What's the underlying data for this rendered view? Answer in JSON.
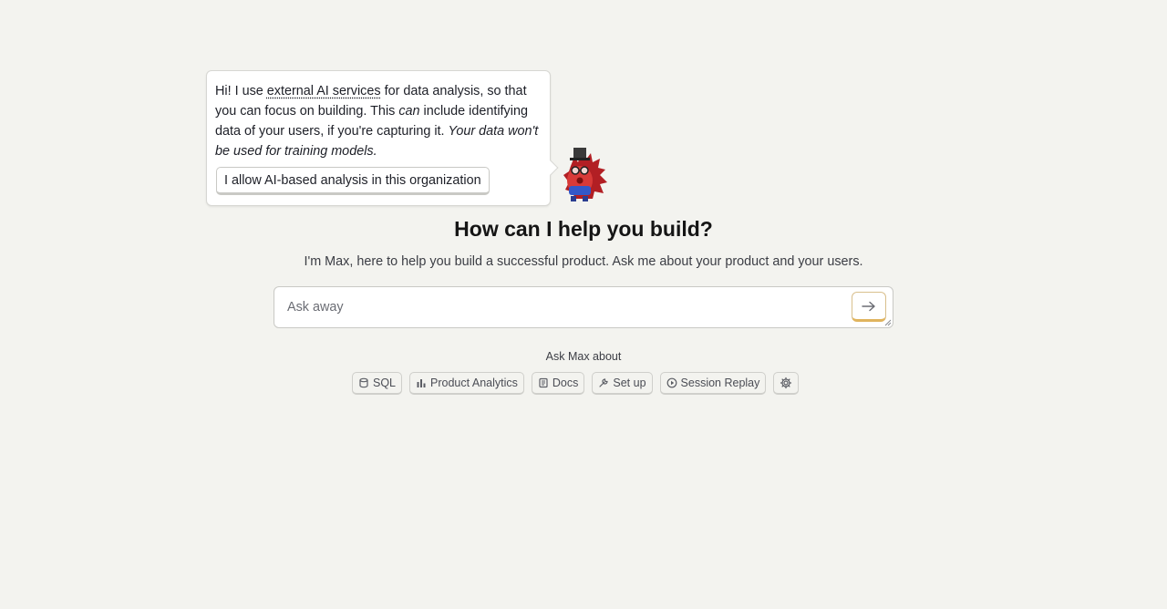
{
  "consent_popover": {
    "text_intro": "Hi! I use ",
    "link_text": "external AI services",
    "text_after_link": " for data analysis, so that you can focus on building. This ",
    "emphasis_word": "can",
    "text_after_emphasis": " include identifying data of your users, if you're capturing it. ",
    "italic_note": "Your data won't be used for training models.",
    "button_label": "I allow AI-based analysis in this organization"
  },
  "hero": {
    "title": "How can I help you build?",
    "subtitle": "I'm Max, here to help you build a successful product. Ask me about your product and your users."
  },
  "ask": {
    "placeholder": "Ask away",
    "send_icon": "arrow-right-icon"
  },
  "suggestions": {
    "label": "Ask Max about",
    "chips": [
      {
        "label": "SQL",
        "icon": "database-icon"
      },
      {
        "label": "Product Analytics",
        "icon": "bar-chart-icon"
      },
      {
        "label": "Docs",
        "icon": "book-icon"
      },
      {
        "label": "Set up",
        "icon": "wrench-icon"
      },
      {
        "label": "Session Replay",
        "icon": "play-circle-icon"
      }
    ],
    "settings_icon": "gear-icon"
  },
  "colors": {
    "background": "#f3f3ef",
    "accent": "#e0b45e",
    "hedgehog_red": "#c8282a"
  }
}
